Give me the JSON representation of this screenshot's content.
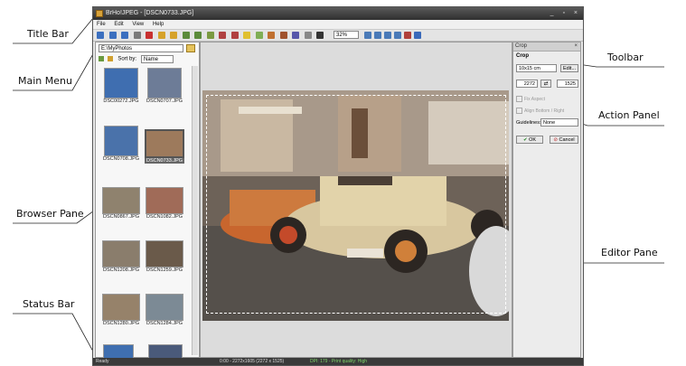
{
  "callouts": {
    "title_bar": "Title Bar",
    "main_menu": "Main Menu",
    "browser_pane": "Browser Pane",
    "status_bar": "Status Bar",
    "toolbar": "Toolbar",
    "action_panel": "Action Panel",
    "editor_pane": "Editor Pane"
  },
  "window": {
    "title": "BrHo!JPEG - [DSCN0733.JPG]",
    "controls": "_ ▫ ×"
  },
  "menu": [
    "File",
    "Edit",
    "View",
    "Help"
  ],
  "toolbar": {
    "zoom_value": "32%",
    "colors": [
      "#3b6fbf",
      "#3b6fbf",
      "#3b6fbf",
      "#7a7a7a",
      "#c83030",
      "#d6a22a",
      "#d6a22a",
      "#5a8a3a",
      "#5a8a3a",
      "#7a9a40",
      "#b04040",
      "#b04040",
      "#e0c030",
      "#7fae55",
      "#c07030",
      "#a0522d",
      "#5555aa",
      "#888888",
      "#333333",
      "#4a7ab8",
      "#4a7ab8",
      "#4a7ab8",
      "#4a7ab8",
      "#b0403a",
      "#3a6aba"
    ]
  },
  "browser": {
    "folder_path": "E:\\MyPhotos",
    "sort_label": "Sort by:",
    "sort_value": "Name",
    "thumbnails": [
      {
        "name": "DSC00272.JPG",
        "color": "#3f6eb0"
      },
      {
        "name": "DSCN0707.JPG",
        "color": "#6d7c97"
      },
      {
        "name": "DSCN0708.JPG",
        "color": "#4a72aa"
      },
      {
        "name": "DSCN0733.JPG",
        "color": "#9d7a5c",
        "selected": true
      },
      {
        "name": "DSCN0867.JPG",
        "color": "#8f826e"
      },
      {
        "name": "DSCN1082.JPG",
        "color": "#a06b58"
      },
      {
        "name": "DSCN1208.JPG",
        "color": "#8a7d6c"
      },
      {
        "name": "DSCN1259.JPG",
        "color": "#6a5a4a"
      },
      {
        "name": "DSCN1280.JPG",
        "color": "#96826a"
      },
      {
        "name": "DSCN1284.JPG",
        "color": "#7c8a95"
      }
    ]
  },
  "panel": {
    "header": "Crop",
    "section": "Crop",
    "size_preset": "10x15 cm",
    "edit_button": "Edit...",
    "width_value": "2272",
    "height_value": "1525",
    "fix_aspect": "Fix Aspect",
    "align_option": "Align Bottom / Right",
    "guidelines_label": "Guidelines:",
    "guidelines_value": "None",
    "ok_button": "OK",
    "cancel_button": "Cancel"
  },
  "status": {
    "ready": "Ready",
    "info": "0:00 - 2272x1605 (2272 x 1525)",
    "quality": "DPI: 179 - Print quality: High"
  }
}
